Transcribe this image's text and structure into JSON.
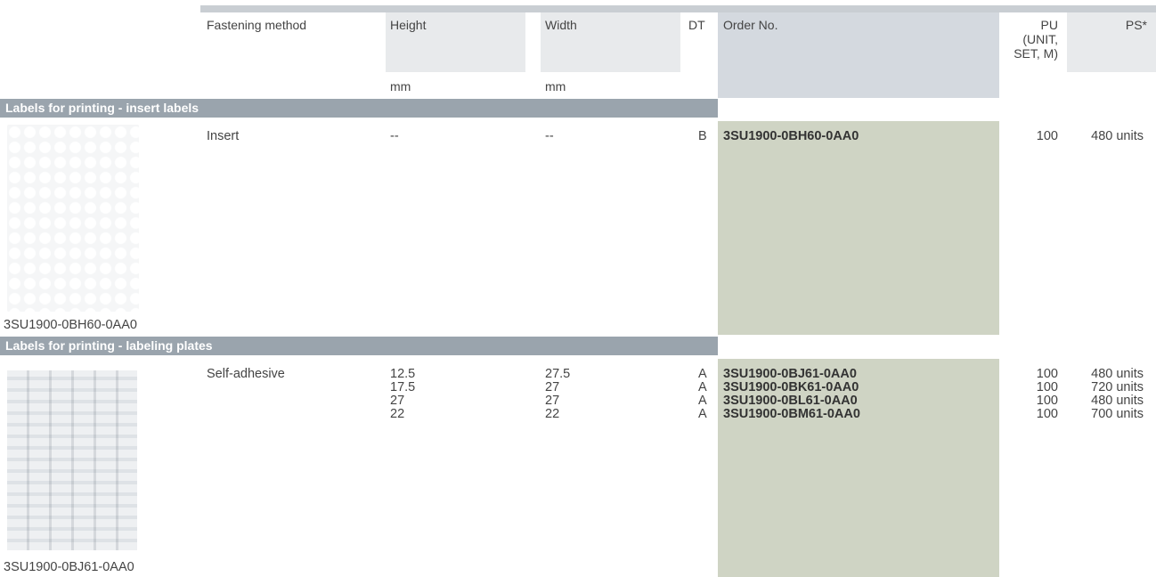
{
  "header": {
    "fastening_method": "Fastening method",
    "height": "Height",
    "width": "Width",
    "dt": "DT",
    "order_no": "Order No.",
    "pu_line1": "PU",
    "pu_line2": "(UNIT,",
    "pu_line3": "SET, M)",
    "ps": "PS*",
    "height_unit": "mm",
    "width_unit": "mm"
  },
  "sections": [
    {
      "title": "Labels for printing - insert labels",
      "image_caption": "3SU1900-0BH60-0AA0",
      "image_icon": "insert-label-sheet-icon",
      "fastening": "Insert",
      "rows": [
        {
          "height": "--",
          "width": "--",
          "dt": "B",
          "order_no": "3SU1900-0BH60-0AA0",
          "pu": "100",
          "ps": "480 units"
        }
      ]
    },
    {
      "title": "Labels for printing - labeling plates",
      "image_caption": "3SU1900-0BJ61-0AA0",
      "image_icon": "labeling-plate-sheet-icon",
      "fastening": "Self-adhesive",
      "rows": [
        {
          "height": "12.5",
          "width": "27.5",
          "dt": "A",
          "order_no": "3SU1900-0BJ61-0AA0",
          "pu": "100",
          "ps": "480 units"
        },
        {
          "height": "17.5",
          "width": "27",
          "dt": "A",
          "order_no": "3SU1900-0BK61-0AA0",
          "pu": "100",
          "ps": "720 units"
        },
        {
          "height": "27",
          "width": "27",
          "dt": "A",
          "order_no": "3SU1900-0BL61-0AA0",
          "pu": "100",
          "ps": "480 units"
        },
        {
          "height": "22",
          "width": "22",
          "dt": "A",
          "order_no": "3SU1900-0BM61-0AA0",
          "pu": "100",
          "ps": "700 units"
        }
      ]
    }
  ],
  "colors": {
    "section_bar": "#9aa4ad",
    "order_column": "#cfd4c4",
    "header_bar": "#c9ced3",
    "header_light": "#e8eaec",
    "header_order": "#d4d9df"
  }
}
